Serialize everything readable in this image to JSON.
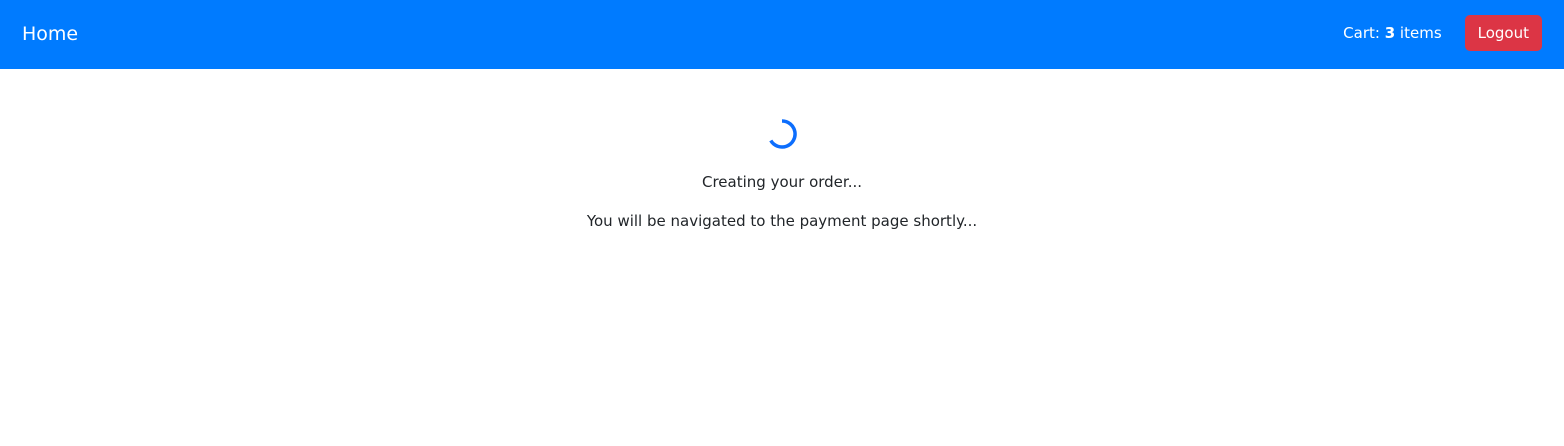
{
  "navbar": {
    "brand": "Home",
    "cart_prefix": "Cart: ",
    "cart_count": "3",
    "cart_suffix": " items",
    "logout_label": "Logout"
  },
  "main": {
    "status": "Creating your order...",
    "subtext": "You will be navigated to the payment page shortly..."
  },
  "colors": {
    "navbar_bg": "#007bff",
    "logout_bg": "#dc3545",
    "spinner": "#0d6efd"
  }
}
